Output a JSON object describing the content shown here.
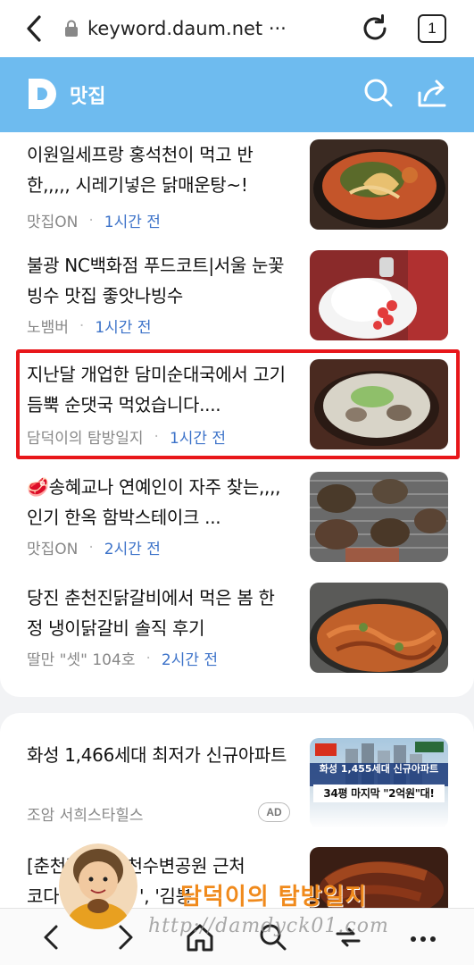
{
  "browser": {
    "url": "keyword.daum.net ···",
    "tab_count": "1"
  },
  "header": {
    "logo_letter": "D",
    "title": "맛집"
  },
  "items": [
    {
      "title": "이원일세프랑 홍석천이 먹고 반한,,,,, 시레기넣은 닭매운탕~!",
      "source": "맛집ON",
      "time": "1시간 전",
      "thumb": "ramen-pot-image"
    },
    {
      "title": "불광 NC백화점 푸드코트|서울 눈꽃빙수 맛집 좋앗나빙수",
      "source": "노뱀버",
      "time": "1시간 전",
      "thumb": "bingsu-image"
    },
    {
      "title": "지난달 개업한 담미순대국에서 고기 듬뿍 순댓국 먹었습니다....",
      "source": "담덕이의 탐방일지",
      "time": "1시간 전",
      "thumb": "sundae-soup-image"
    },
    {
      "title": "🥩송혜교나 연예인이 자주 찾는,,,,인기 한옥 함박스테이크 ...",
      "source": "맛집ON",
      "time": "2시간 전",
      "thumb": "hamburg-steak-image"
    },
    {
      "title": "당진 춘천진닭갈비에서 먹은 봄 한정 냉이닭갈비 솔직 후기",
      "source": "딸만 \"셋\" 104호",
      "time": "2시간 전",
      "thumb": "dakgalbi-image"
    }
  ],
  "ad": {
    "title": "화성 1,466세대 최저가 신규아파트",
    "source": "조암 서희스타힐스",
    "badge": "AD",
    "overlay_line1": "화성 1,455세대 신규아파트",
    "overlay_line2": "34평 마지막 \"2억원\"대!"
  },
  "partial_item": {
    "line1": "[춘천맛집] 춘천수변공원 근처",
    "line2_left": "코다",
    "line2_right": "', '김봉",
    "thumb": "braised-fish-image"
  },
  "watermark": {
    "url": "http://damdyck01.com",
    "name": "담덕이의 탐방일지"
  },
  "colors": {
    "header_bg": "#6ebbef",
    "time_blue": "#3d73c9",
    "highlight_red": "#e8161a",
    "watermark_orange": "#f08a1c"
  },
  "nav": [
    "back-icon",
    "forward-icon",
    "home-icon",
    "search-icon",
    "tabs-icon",
    "more-icon"
  ]
}
